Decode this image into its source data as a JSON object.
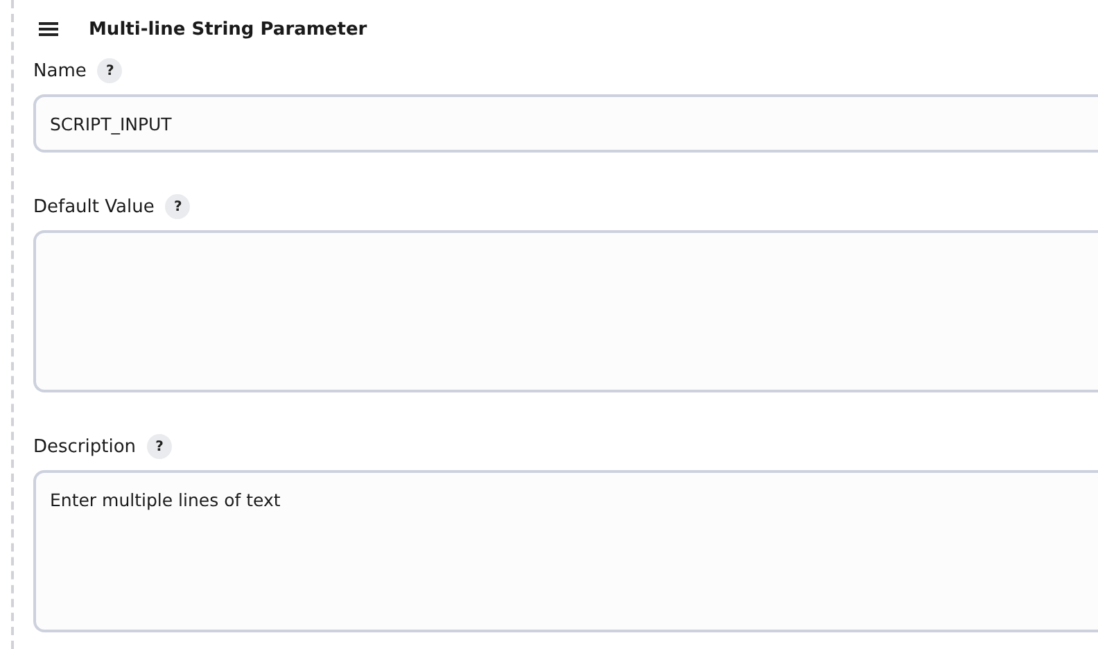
{
  "section": {
    "title": "Multi-line String Parameter"
  },
  "fields": [
    {
      "kind": "input",
      "label": "Name",
      "help": "?",
      "value": "SCRIPT_INPUT"
    },
    {
      "kind": "textarea",
      "label": "Default Value",
      "help": "?"
    },
    {
      "kind": "textarea",
      "label": "Description",
      "help": "?",
      "value": "Enter multiple lines of text"
    }
  ]
}
